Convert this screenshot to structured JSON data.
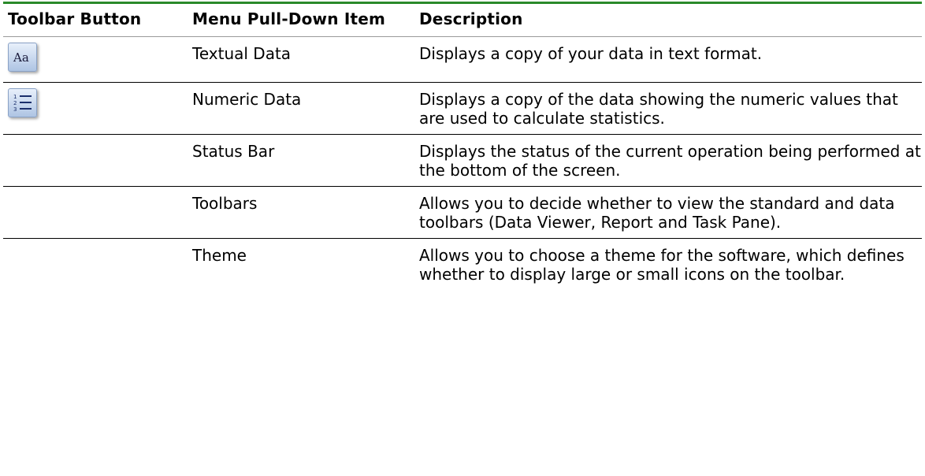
{
  "table": {
    "headers": [
      "Toolbar Button",
      "Menu Pull-Down Item",
      "Description"
    ],
    "rows": [
      {
        "icon": "textual-data-icon",
        "icon_glyph": "Aa",
        "item": "Textual Data",
        "description": "Displays a copy of your data in text format."
      },
      {
        "icon": "numeric-data-icon",
        "item": "Numeric Data",
        "description": "Displays a copy of the data showing the numeric values that are used to calculate statistics."
      },
      {
        "item": "Status Bar",
        "description": "Displays the status of the current operation being performed at the bottom of the screen."
      },
      {
        "item": "Toolbars",
        "description": "Allows you to decide whether to view the standard and data toolbars (Data Viewer, Report and Task Pane)."
      },
      {
        "item": "Theme",
        "description": "Allows you to choose a theme for the software, which defines whether to display large or small icons on the toolbar."
      }
    ]
  },
  "colors": {
    "top_rule": "#2a8a2a",
    "icon_fill": "#aec4e3"
  }
}
